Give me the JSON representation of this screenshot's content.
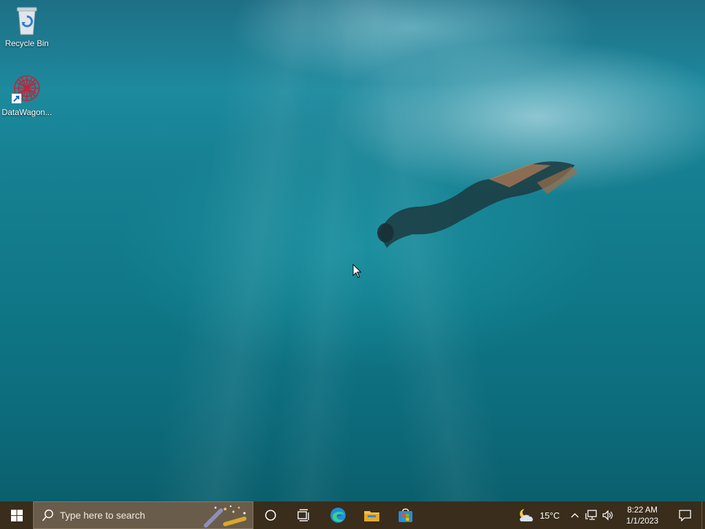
{
  "desktop": {
    "icons": [
      {
        "label": "Recycle Bin",
        "icon": "recycle-bin-icon"
      },
      {
        "label": "DataWagon...",
        "icon": "datawagon-icon"
      }
    ]
  },
  "taskbar": {
    "start_icon": "windows-logo-icon",
    "search": {
      "placeholder": "Type here to search",
      "icon": "search-icon"
    },
    "apps": [
      {
        "name": "Cortana",
        "icon": "cortana-icon"
      },
      {
        "name": "Task View",
        "icon": "task-view-icon"
      },
      {
        "name": "Microsoft Edge",
        "icon": "edge-icon"
      },
      {
        "name": "File Explorer",
        "icon": "file-explorer-icon"
      },
      {
        "name": "Microsoft Store",
        "icon": "store-icon"
      }
    ],
    "weather": {
      "temp": "15°C",
      "icon": "partly-cloudy-night-icon"
    },
    "tray_icons": [
      "chevron-up-icon",
      "network-icon",
      "volume-icon"
    ],
    "clock": {
      "time": "8:22 AM",
      "date": "1/1/2023"
    },
    "notification_icon": "notification-icon"
  },
  "colors": {
    "taskbar_bg": "#3a2d1c",
    "search_bg": "#6a5c4a",
    "water_accent": "#1d8a9e"
  }
}
